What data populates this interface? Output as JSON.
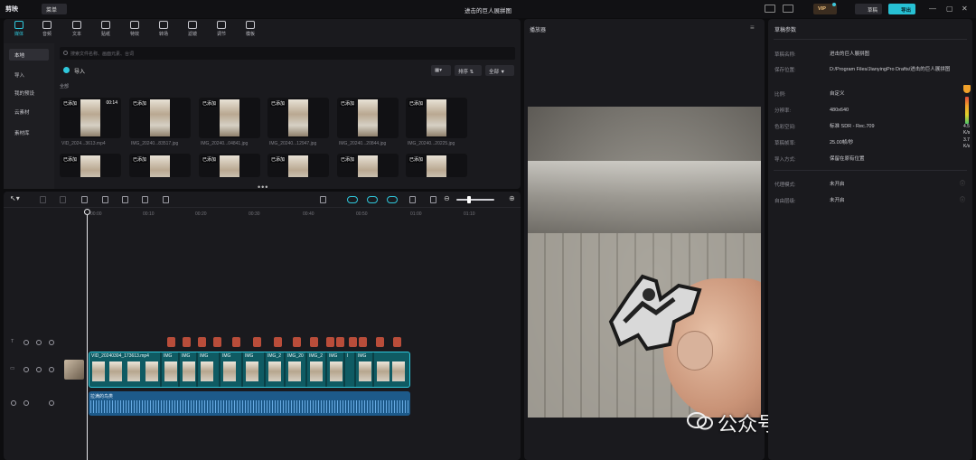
{
  "app": {
    "logo": "剪映",
    "menu_label": "菜单",
    "title": "进击的巨人展拼图",
    "vip_label": "VIP",
    "save_label": "草稿",
    "export_label": "导出"
  },
  "toolbar": {
    "tools": [
      {
        "label": "媒体",
        "icon": "media-icon"
      },
      {
        "label": "音频",
        "icon": "audio-icon"
      },
      {
        "label": "文本",
        "icon": "text-icon"
      },
      {
        "label": "贴纸",
        "icon": "sticker-icon"
      },
      {
        "label": "特效",
        "icon": "effects-icon"
      },
      {
        "label": "转场",
        "icon": "transition-icon"
      },
      {
        "label": "滤镜",
        "icon": "filter-icon"
      },
      {
        "label": "调节",
        "icon": "adjust-icon"
      },
      {
        "label": "模板",
        "icon": "template-icon"
      }
    ]
  },
  "sidebar": {
    "items": [
      "本地",
      "导入",
      "我的预设",
      "云素材",
      "素材库"
    ]
  },
  "media": {
    "search_placeholder": "搜索文件名称、画面元素、台词",
    "import_label": "导入",
    "sort_label": "排序",
    "filter_label": "全部",
    "section_label": "全部",
    "added_tag": "已添加",
    "items": [
      {
        "name": "VID_2024...3613.mp4",
        "duration": "00:14"
      },
      {
        "name": "IMG_20240...83517.jpg",
        "duration": ""
      },
      {
        "name": "IMG_20240...04841.jpg",
        "duration": ""
      },
      {
        "name": "IMG_20240...12947.jpg",
        "duration": ""
      },
      {
        "name": "IMG_20240...20844.jpg",
        "duration": ""
      },
      {
        "name": "IMG_20240...20225.jpg",
        "duration": ""
      }
    ]
  },
  "player": {
    "title": "播放器"
  },
  "watermark": "公众号 · 辰匠之心",
  "properties": {
    "title": "草稿参数",
    "rows": [
      {
        "label": "草稿名称:",
        "value": "进击的巨人展拼图"
      },
      {
        "label": "保存位置:",
        "value": "D:/Program Files/JianyingPro Drafts/进击的巨人展拼图"
      },
      {
        "label": "比例:",
        "value": "自定义"
      },
      {
        "label": "分辨率:",
        "value": "480x640"
      },
      {
        "label": "色彩空间:",
        "value": "标准 SDR - Rec.709"
      },
      {
        "label": "草稿帧率:",
        "value": "25.00帧/秒"
      },
      {
        "label": "导入方式:",
        "value": "保留在原有位置"
      },
      {
        "label": "代理模式:",
        "value": "未开启"
      },
      {
        "label": "自由层级:",
        "value": "未开启"
      }
    ],
    "side_values": [
      "4.5",
      "K/s",
      "3.7",
      "K/s"
    ]
  },
  "timeline": {
    "ticks": [
      "00:00",
      "00:10",
      "00:20",
      "00:30",
      "00:40",
      "00:50",
      "01:00",
      "01:10"
    ],
    "video_clips": [
      "VID_20240304_173613.mp4",
      "IMG",
      "IMG",
      "IMG",
      "IMG",
      "IMG",
      "IMG_2",
      "IMG_20",
      "IMG_2",
      "IMG",
      "I",
      "IMG"
    ],
    "audio_label": "拉满的鸟类"
  }
}
